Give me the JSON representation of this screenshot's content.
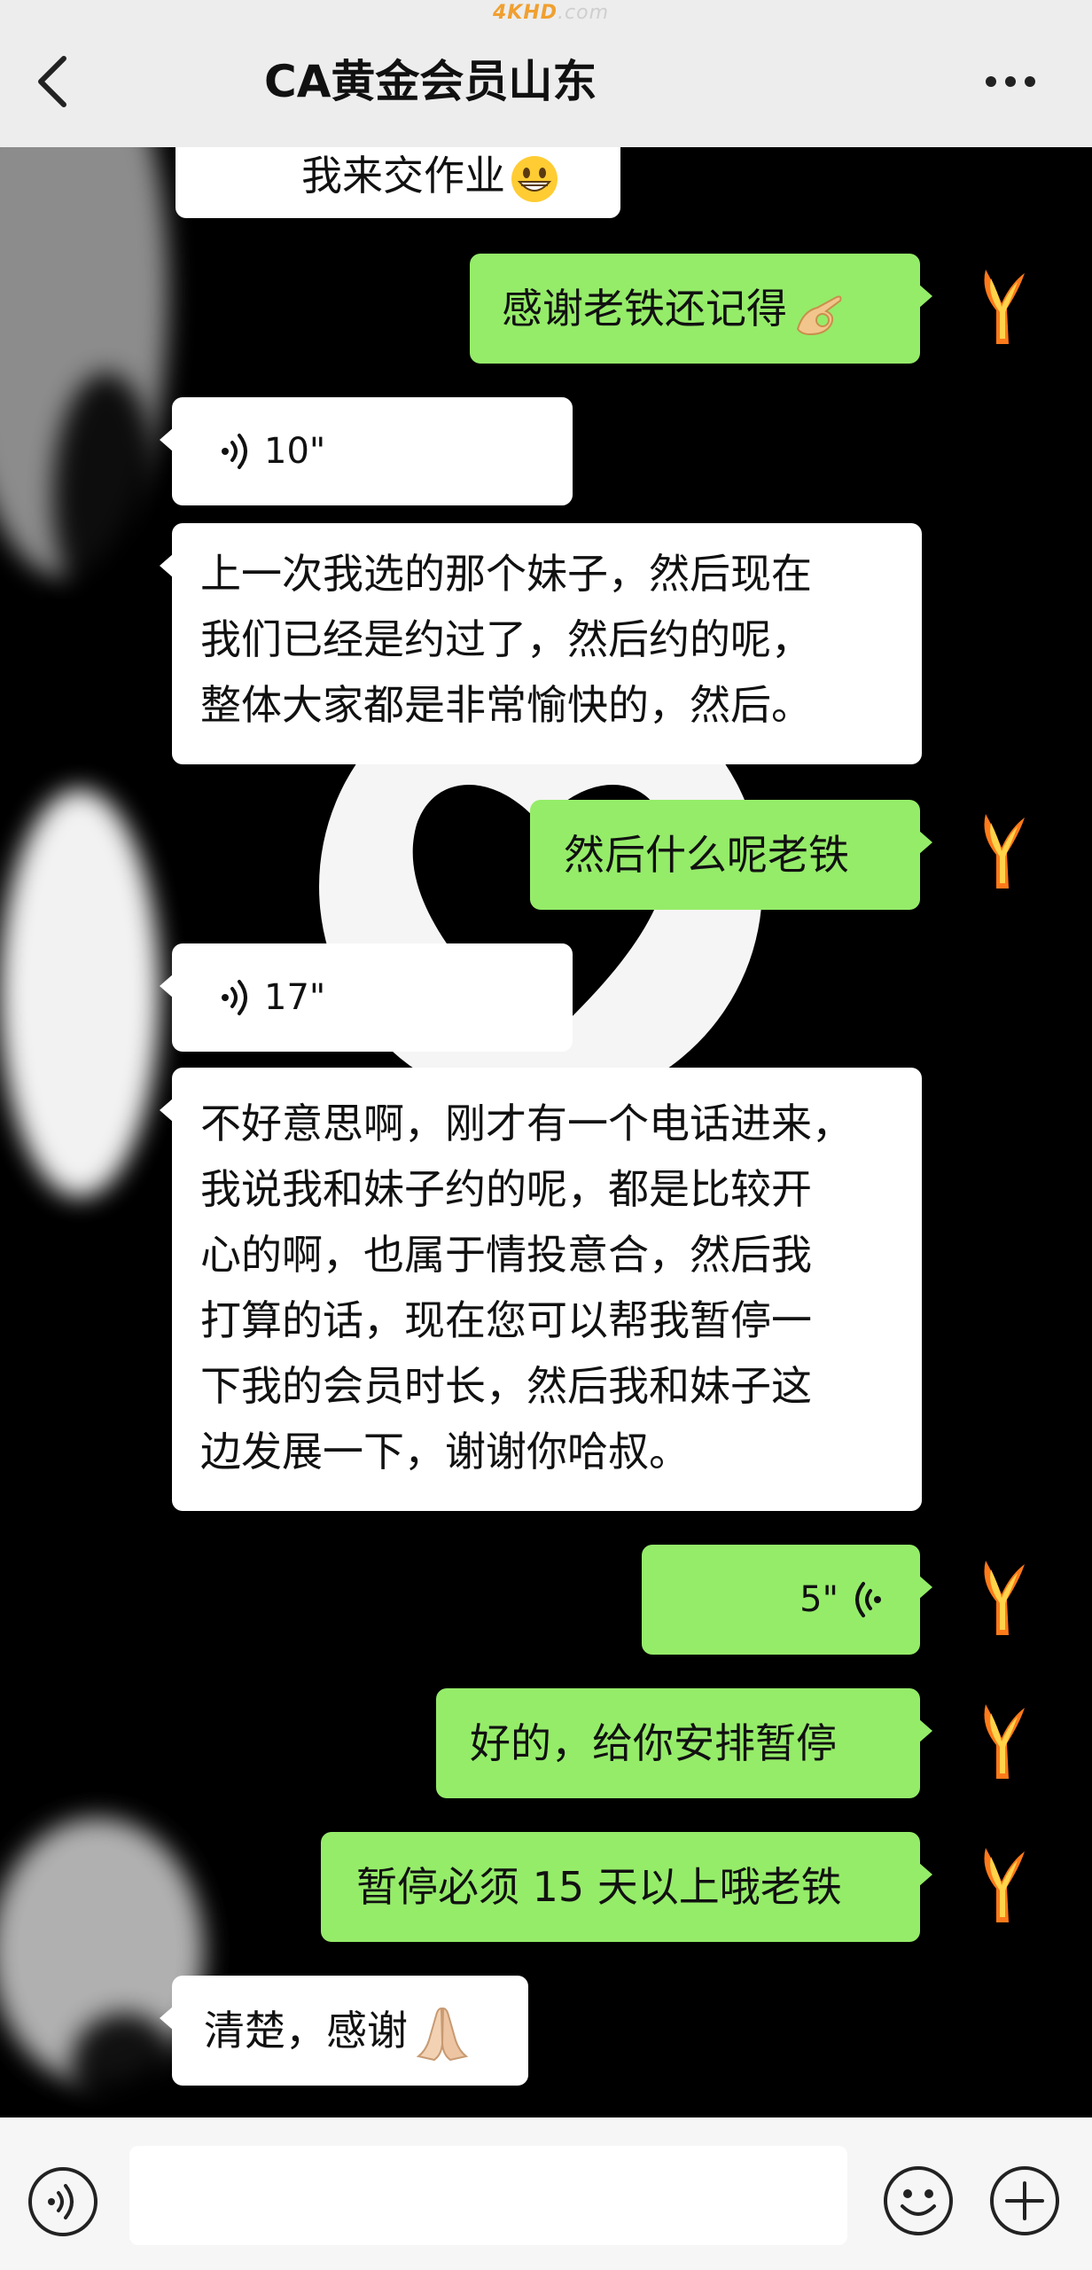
{
  "header": {
    "title": "CA黄金会员山东",
    "watermark_brand": "4KHD",
    "watermark_suffix": ".com"
  },
  "messages": [
    {
      "id": "m1",
      "side": "left",
      "type": "text",
      "text": "我来交作业",
      "emoji": "grinning-face"
    },
    {
      "id": "m2",
      "side": "right",
      "type": "text",
      "text": "感谢老铁还记得",
      "emoji": "ok-hand"
    },
    {
      "id": "m3",
      "side": "left",
      "type": "voice",
      "duration": "10\""
    },
    {
      "id": "m4",
      "side": "left",
      "type": "text",
      "lines": [
        "上一次我选的那个妹子，然后现在",
        "我们已经是约过了，然后约的呢，",
        "整体大家都是非常愉快的，然后。"
      ]
    },
    {
      "id": "m5",
      "side": "right",
      "type": "text",
      "text": "然后什么呢老铁"
    },
    {
      "id": "m6",
      "side": "left",
      "type": "voice",
      "duration": "17\""
    },
    {
      "id": "m7",
      "side": "left",
      "type": "text",
      "lines": [
        "不好意思啊，刚才有一个电话进来，",
        "我说我和妹子约的呢，都是比较开",
        "心的啊，也属于情投意合，然后我",
        "打算的话，现在您可以帮我暂停一",
        "下我的会员时长，然后我和妹子这",
        "边发展一下，谢谢你哈叔。"
      ]
    },
    {
      "id": "m8",
      "side": "right",
      "type": "voice",
      "duration": "5\""
    },
    {
      "id": "m9",
      "side": "right",
      "type": "text",
      "text": "好的，给你安排暂停"
    },
    {
      "id": "m10",
      "side": "right",
      "type": "text",
      "text": "暂停必须 15 天以上哦老铁"
    },
    {
      "id": "m11",
      "side": "left",
      "type": "text",
      "text": "清楚，感谢",
      "emoji": "folded-hands"
    }
  ],
  "icons": {
    "back": "chevron-left-icon",
    "more": "more-dots-icon",
    "voice": "voice-wave-icon",
    "emoji": "emoji-smile-icon",
    "plus": "plus-circle-icon",
    "avatar": "flame-y-avatar"
  },
  "colors": {
    "header_bg": "#ededed",
    "chat_bg": "#000000",
    "bubble_me": "#95ec69",
    "bubble_other": "#ffffff",
    "input_bar_bg": "#f6f6f6"
  }
}
